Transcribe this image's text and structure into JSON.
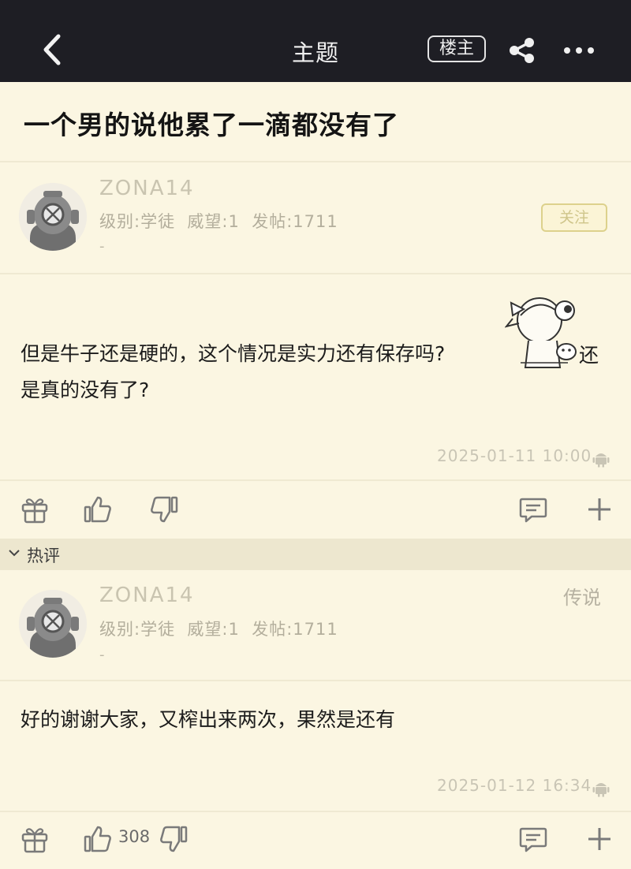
{
  "topbar": {
    "title": "主题",
    "owner_badge": "楼主"
  },
  "thread": {
    "title": "一个男的说他累了一滴都没有了"
  },
  "post": {
    "username": "ZONA14",
    "meta": "级别:学徒  威望:1  发帖:1711",
    "signature": "-",
    "follow_label": "关注",
    "content_line1": "但是牛子还是硬的，这个情况是实力还有保存吗?",
    "content_tail": "还",
    "content_line2": "是真的没有了?",
    "time": "2025-01-11 10:00"
  },
  "hot_section": {
    "label": "热评"
  },
  "hot_comment": {
    "username": "ZONA14",
    "meta": "级别:学徒  威望:1  发帖:1711",
    "signature": "-",
    "rank": "传说",
    "content": "好的谢谢大家，又榨出来两次，果然是还有",
    "time": "2025-01-12 16:34",
    "like_count": "308"
  },
  "icons": {
    "back": "chevron-left-icon",
    "share": "share-icon",
    "more": "more-dots-icon",
    "gift": "gift-icon",
    "like": "thumbs-up-icon",
    "dislike": "thumbs-down-icon",
    "comment": "comment-icon",
    "add": "plus-icon",
    "android": "android-icon"
  },
  "colors": {
    "topbar": "#1e1e24",
    "page_bg": "#fbf6e2",
    "hot_bar": "#ede7cf",
    "follow_border": "#ddd18c"
  }
}
